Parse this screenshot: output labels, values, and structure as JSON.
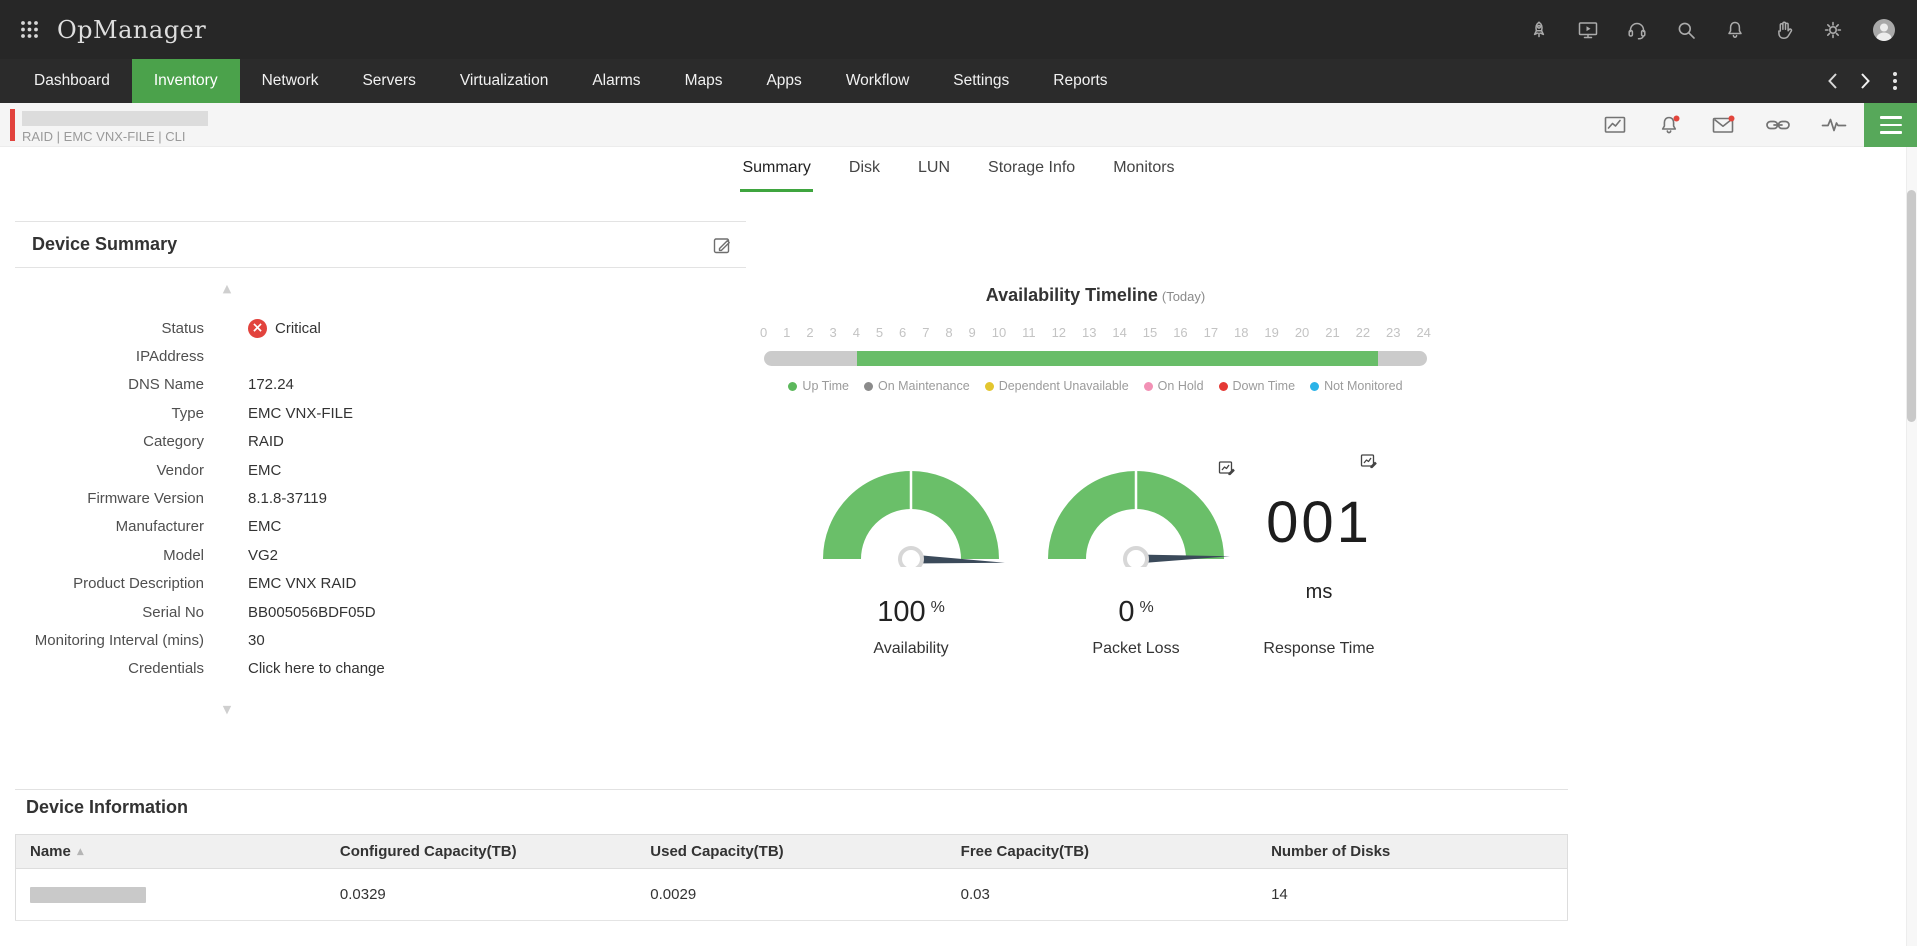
{
  "colors": {
    "accent_green": "#4BA24B",
    "gauge_green": "#6ABF69",
    "timeline_green": "#68BD68",
    "critical_red": "#E2433D",
    "topbar_bg": "#272727",
    "nav_bg": "#2b2b2b"
  },
  "brand": {
    "logo": "OpManager"
  },
  "topbar": {
    "icons": [
      "apps-grid-icon",
      "whats-new-rocket-icon",
      "screen-demo-icon",
      "support-headset-icon",
      "search-icon",
      "notifications-bell-icon",
      "gesture-hand-icon",
      "settings-gear-icon",
      "user-avatar"
    ]
  },
  "nav": {
    "items": [
      {
        "label": "Dashboard",
        "active": false
      },
      {
        "label": "Inventory",
        "active": true
      },
      {
        "label": "Network",
        "active": false
      },
      {
        "label": "Servers",
        "active": false
      },
      {
        "label": "Virtualization",
        "active": false
      },
      {
        "label": "Alarms",
        "active": false
      },
      {
        "label": "Maps",
        "active": false
      },
      {
        "label": "Apps",
        "active": false
      },
      {
        "label": "Workflow",
        "active": false
      },
      {
        "label": "Settings",
        "active": false
      },
      {
        "label": "Reports",
        "active": false
      }
    ]
  },
  "device_header": {
    "breadcrumb": "RAID | EMC VNX-FILE  | CLI",
    "severity": "critical",
    "icons": [
      "performance-chart-icon",
      "alarm-bell-icon",
      "email-icon",
      "link-icon",
      "response-pulse-icon",
      "hamburger-menu"
    ]
  },
  "tabs": {
    "items": [
      {
        "label": "Summary",
        "active": true
      },
      {
        "label": "Disk",
        "active": false
      },
      {
        "label": "LUN",
        "active": false
      },
      {
        "label": "Storage Info",
        "active": false
      },
      {
        "label": "Monitors",
        "active": false
      }
    ]
  },
  "device_summary": {
    "title": "Device Summary",
    "fields": [
      {
        "label": "Status",
        "value": "Critical"
      },
      {
        "label": "IPAddress",
        "value": ""
      },
      {
        "label": "DNS Name",
        "value": "172.24"
      },
      {
        "label": "Type",
        "value": "EMC VNX-FILE"
      },
      {
        "label": "Category",
        "value": "RAID"
      },
      {
        "label": "Vendor",
        "value": "EMC"
      },
      {
        "label": "Firmware Version",
        "value": "8.1.8-37119"
      },
      {
        "label": "Manufacturer",
        "value": "EMC"
      },
      {
        "label": "Model",
        "value": "VG2"
      },
      {
        "label": "Product Description",
        "value": "EMC VNX RAID"
      },
      {
        "label": "Serial No",
        "value": "BB005056BDF05D"
      },
      {
        "label": "Monitoring Interval (mins)",
        "value": "30"
      },
      {
        "label": "Credentials",
        "value": "Click here to change"
      }
    ]
  },
  "timeline": {
    "title": "Availability Timeline",
    "subtitle": "(Today)",
    "hours": [
      "0",
      "1",
      "2",
      "3",
      "4",
      "5",
      "6",
      "7",
      "8",
      "9",
      "10",
      "11",
      "12",
      "13",
      "14",
      "15",
      "16",
      "17",
      "18",
      "19",
      "20",
      "21",
      "22",
      "23",
      "24"
    ],
    "segments": [
      {
        "status": "not-monitored",
        "color": "#CBCBCB",
        "width": "14%"
      },
      {
        "status": "up-time",
        "color": "#68BD68",
        "width": "78.6%"
      },
      {
        "status": "not-monitored",
        "color": "#CBCBCB",
        "width": "7.4%"
      }
    ],
    "legend": [
      {
        "label": "Up Time",
        "color": "#5CB85C"
      },
      {
        "label": "On Maintenance",
        "color": "#8B8B8B"
      },
      {
        "label": "Dependent Unavailable",
        "color": "#E3C62F"
      },
      {
        "label": "On Hold",
        "color": "#F291B5"
      },
      {
        "label": "Down Time",
        "color": "#E53935"
      },
      {
        "label": "Not Monitored",
        "color": "#2BB3E8"
      }
    ]
  },
  "metrics": {
    "availability": {
      "value": "100",
      "unit": "%",
      "label": "Availability"
    },
    "packet_loss": {
      "value": "0",
      "unit": "%",
      "label": "Packet Loss"
    },
    "response_time": {
      "value": "001",
      "unit": "ms",
      "label": "Response Time"
    }
  },
  "device_information": {
    "title": "Device Information",
    "columns": [
      "Name",
      "Configured Capacity(TB)",
      "Used Capacity(TB)",
      "Free Capacity(TB)",
      "Number of Disks"
    ],
    "rows": [
      {
        "name": "",
        "configured": "0.0329",
        "used": "0.0029",
        "free": "0.03",
        "disks": "14"
      }
    ]
  },
  "glyphs": {
    "sort": "▲",
    "scroll_up": "▲",
    "scroll_down": "▼",
    "critical": "×"
  },
  "chart_data": [
    {
      "type": "gauge",
      "title": "Availability",
      "value": 100,
      "unit": "%",
      "range": [
        0,
        100
      ],
      "color": "#6ABF69"
    },
    {
      "type": "gauge",
      "title": "Packet Loss",
      "value": 0,
      "unit": "%",
      "range": [
        0,
        100
      ],
      "color": "#6ABF69"
    },
    {
      "type": "number",
      "title": "Response Time",
      "value": 1,
      "display": "001",
      "unit": "ms"
    },
    {
      "type": "timeline",
      "title": "Availability Timeline (Today)",
      "x_ticks": [
        0,
        1,
        2,
        3,
        4,
        5,
        6,
        7,
        8,
        9,
        10,
        11,
        12,
        13,
        14,
        15,
        16,
        17,
        18,
        19,
        20,
        21,
        22,
        23,
        24
      ],
      "segments": [
        {
          "status": "not-monitored",
          "start_hour": 0,
          "end_hour": 3.4
        },
        {
          "status": "up-time",
          "start_hour": 3.4,
          "end_hour": 22.3
        },
        {
          "status": "not-monitored",
          "start_hour": 22.3,
          "end_hour": 24
        }
      ],
      "legend": [
        "Up Time",
        "On Maintenance",
        "Dependent Unavailable",
        "On Hold",
        "Down Time",
        "Not Monitored"
      ]
    }
  ]
}
